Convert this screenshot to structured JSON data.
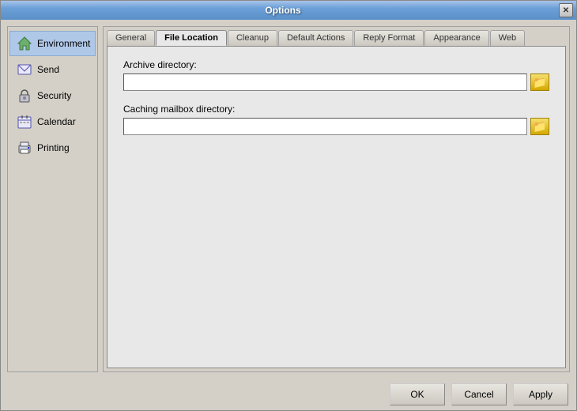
{
  "window": {
    "title": "Options",
    "close_label": "✕"
  },
  "sidebar": {
    "items": [
      {
        "id": "environment",
        "label": "Environment",
        "icon": "home"
      },
      {
        "id": "send",
        "label": "Send",
        "icon": "send"
      },
      {
        "id": "security",
        "label": "Security",
        "icon": "lock"
      },
      {
        "id": "calendar",
        "label": "Calendar",
        "icon": "calendar"
      },
      {
        "id": "printing",
        "label": "Printing",
        "icon": "print"
      }
    ],
    "active": "environment"
  },
  "tabs": {
    "items": [
      {
        "id": "general",
        "label": "General"
      },
      {
        "id": "file-location",
        "label": "File Location"
      },
      {
        "id": "cleanup",
        "label": "Cleanup"
      },
      {
        "id": "default-actions",
        "label": "Default Actions"
      },
      {
        "id": "reply-format",
        "label": "Reply Format"
      },
      {
        "id": "appearance",
        "label": "Appearance"
      },
      {
        "id": "web",
        "label": "Web"
      }
    ],
    "active": "file-location"
  },
  "fields": {
    "archive_label": "Archive directory:",
    "archive_placeholder": "",
    "caching_label": "Caching mailbox directory:",
    "caching_placeholder": ""
  },
  "buttons": {
    "ok": "OK",
    "cancel": "Cancel",
    "apply": "Apply"
  }
}
